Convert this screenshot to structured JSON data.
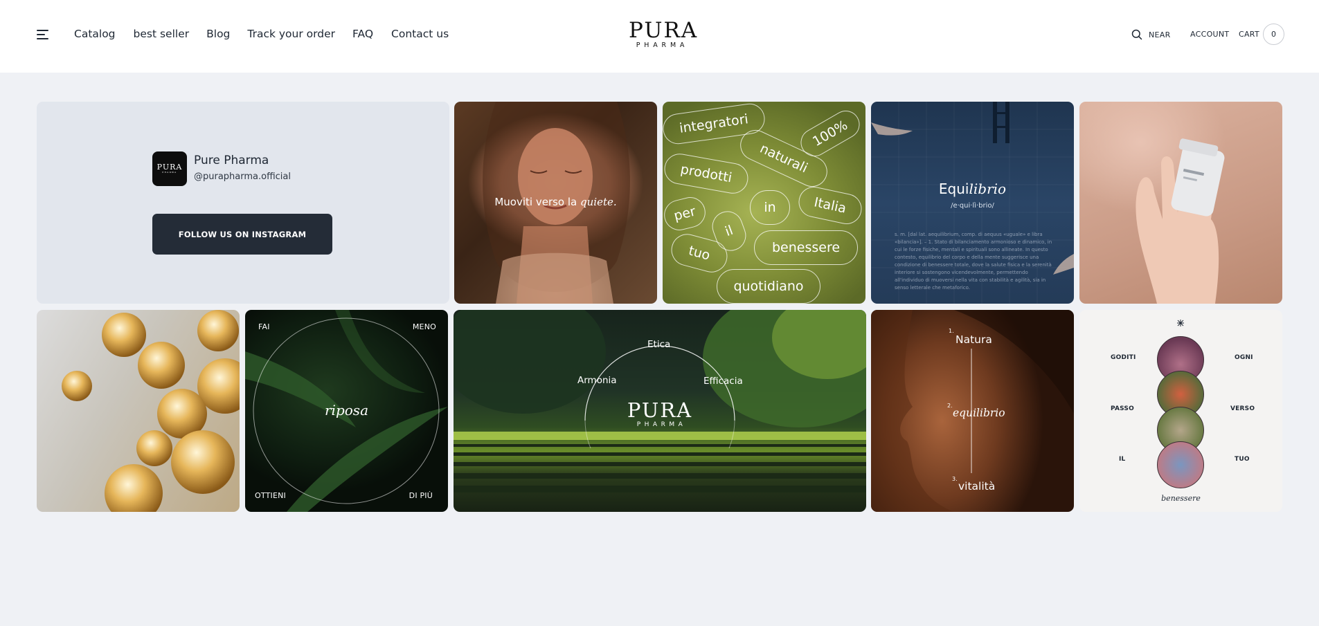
{
  "header": {
    "nav": [
      "Catalog",
      "best seller",
      "Blog",
      "Track your order",
      "FAQ",
      "Contact us"
    ],
    "logo_main": "PURA",
    "logo_sub": "PHARMA",
    "search_label": "NEAR",
    "account_label": "ACCOUNT",
    "cart_label": "CART",
    "cart_count": "0"
  },
  "profile": {
    "avatar_main": "PURA",
    "avatar_sub": "PHARMA",
    "name": "Pure Pharma",
    "handle": "@purapharma.official",
    "follow_label": "FOLLOW US ON INSTAGRAM"
  },
  "tiles": {
    "quiete": {
      "text": "Muoviti verso la ",
      "italic": "quiete."
    },
    "words": [
      "integratori",
      "100%",
      "naturali",
      "prodotti",
      "in",
      "Italia",
      "per",
      "il",
      "benessere",
      "tuo",
      "quotidiano"
    ],
    "equilibrio": {
      "title_plain": "Equi",
      "title_italic": "librio",
      "phonetic": "/e·qui·lì·brio/",
      "definition": "s. m. [dal lat. aequilibrium, comp. di aequus «uguale» e libra «bilancia»]. – 1. Stato di bilanciamento armonioso e dinamico, in cui le forze fisiche, mentali e spirituali sono allineate. In questo contesto, equilibrio del corpo e della mente suggerisce una condizione di benessere totale, dove la salute fisica e la serenità interiore si sostengono vicendevolmente, permettendo all'individuo di muoversi nella vita con stabilità e agilità, sia in senso letterale che metaforico."
    },
    "riposa": {
      "fai": "FAI",
      "meno": "MENO",
      "ottieni": "OTTIENI",
      "di_piu": "DI PIÙ",
      "word": "riposa"
    },
    "etica": {
      "etica": "Etica",
      "armonia": "Armonia",
      "efficacia": "Efficacia",
      "logo_main": "PURA",
      "logo_sub": "PHARMA"
    },
    "natura": {
      "n1": "1.",
      "w1": "Natura",
      "n2": "2.",
      "w2": "equilibrio",
      "n3": "3.",
      "w3": "vitalità"
    },
    "goditi": {
      "goditi": "GODITI",
      "ogni": "OGNI",
      "passo": "PASSO",
      "verso": "VERSO",
      "il": "IL",
      "tuo": "TUO",
      "bottom": "benessere"
    }
  },
  "colors": {
    "background": "#eff1f5",
    "header_bg": "#ffffff",
    "text_dark": "#1e2733",
    "button_bg": "#242c37",
    "profile_tile_bg": "#e2e6ed"
  },
  "icons": {
    "menu": "menu-icon",
    "search": "search-icon"
  }
}
